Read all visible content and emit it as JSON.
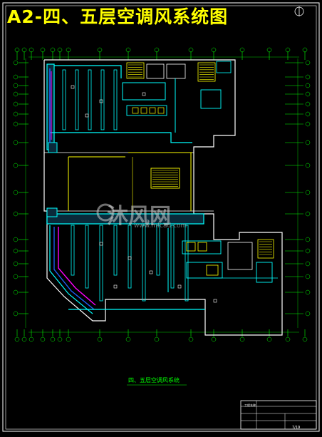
{
  "drawing": {
    "title": "A2-四、五层空调风系统图",
    "caption": "四、五层空调风系统",
    "watermark": "沐风网",
    "watermark_sub": "www.mfcad.com",
    "title_block_label": "工程名称",
    "sheet_number": "7/19"
  },
  "colors": {
    "background": "#000000",
    "frame": "#ffffff",
    "walls": "#ffffff",
    "duct": "#00ffff",
    "duct_fill": "#0a2a3a",
    "grid": "#00ff00",
    "accent": "#ffff00",
    "special_duct": "#ff00ff",
    "blue_duct": "#2060ff",
    "title": "#ffff00"
  },
  "icons": [
    "north-arrow-icon",
    "vortex-watermark-icon"
  ]
}
